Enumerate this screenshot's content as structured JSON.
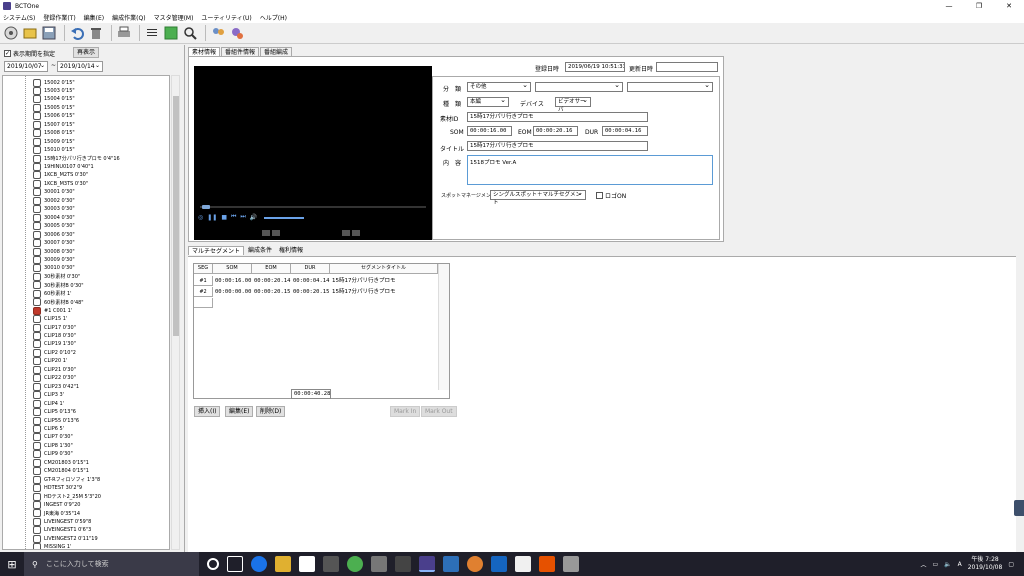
{
  "window": {
    "title": "BCTOne",
    "controls": [
      "—",
      "❐",
      "✕"
    ]
  },
  "menu": [
    "システム(S)",
    "登録作業(T)",
    "編集(E)",
    "編成作業(Q)",
    "マスタ管理(M)",
    "ユーティリティ(U)",
    "ヘルプ(H)"
  ],
  "left": {
    "show_period_label": "表示期間を指定",
    "show_period_checked": true,
    "redisplay_button": "再表示",
    "date_from": "2019/10/07",
    "date_to": "2019/10/14",
    "date_sep": "~",
    "tree_items": [
      "15002 0'15\"",
      "15003 0'15\"",
      "15004 0'15\"",
      "15005 0'15\"",
      "15006 0'15\"",
      "15007 0'15\"",
      "15008 0'15\"",
      "15009 0'15\"",
      "15010 0'15\"",
      "15時17分パリ行きプロモ 0'4\"16",
      "19HINU0107 0'40\"1",
      "1KCB_M2TS 0'30\"",
      "1KCB_M3TS 0'30\"",
      "30001 0'30\"",
      "30002 0'30\"",
      "30003 0'30\"",
      "30004 0'30\"",
      "30005 0'30\"",
      "30006 0'30\"",
      "30007 0'30\"",
      "30008 0'30\"",
      "30009 0'30\"",
      "30010 0'30\"",
      "30秒素材 0'30\"",
      "30秒素材B 0'30\"",
      "60秒素材 1'",
      "60秒素材B 0'48\"",
      "#1 C001 1'",
      "CLIP15 1'",
      "CLIP17 0'30\"",
      "CLIP18 0'30\"",
      "CLIP19 1'30\"",
      "CLIP2 0'10\"2",
      "CLIP20 1'",
      "CLIP21 0'30\"",
      "CLIP22 0'30\"",
      "CLIP23 0'42\"1",
      "CLIP3 3'",
      "CLIP4 1'",
      "CLIP5 0'13\"6",
      "CLIP55 0'13\"6",
      "CLIP6 5'",
      "CLIP7 0'30\"",
      "CLIP8 1'30\"",
      "CLIP9 0'30\"",
      "CM201803 0'15\"1",
      "CM201804 0'15\"1",
      "GT-Rフィロソフィ 1'3\"8",
      "HDTEST 30'2\"9",
      "HDテスト2_25M 5'3\"20",
      "INGEST 0'9\"20",
      "JR東海 0'35\"14",
      "LIVEINGEST 0'59\"8",
      "LIVEINGEST1 0'6\"3",
      "LIVEINGEST2 0'11\"19",
      "MISSING 1'"
    ]
  },
  "tabs": [
    "素材情報",
    "番組件情報",
    "番組編成"
  ],
  "form": {
    "reg_date_label": "登録日時",
    "reg_date": "2019/06/19 10:51:33",
    "upd_date_label": "更新日時",
    "upd_date": "",
    "category_label": "分　類",
    "category_value": "その他",
    "kind_label": "種　類",
    "kind_value": "本編",
    "device_label": "デバイス",
    "device_value": "ビデオサーバ",
    "material_id_label": "素材ID",
    "material_id": "15時17分パリ行きプロモ",
    "som_label": "SOM",
    "som": "00:00:16.00",
    "eom_label": "EOM",
    "eom": "00:00:20.16",
    "dur_label": "DUR",
    "dur": "00:00:04.16",
    "title_label": "タイトル",
    "title": "15時17分パリ行きプロモ",
    "content_label": "内　容",
    "content": "1518プロモ Ver.A",
    "spot_label": "スポットマネージメント",
    "spot_value": "シングルスポット＋マルチセグメント",
    "logo_label": "ロゴON",
    "logo_checked": false
  },
  "lower_tabs": [
    "マルチセグメント",
    "編成条件",
    "権利情報"
  ],
  "grid": {
    "headers": [
      "SEG",
      "SOM",
      "EOM",
      "DUR",
      "セグメントタイトル"
    ],
    "rows": [
      {
        "seg": "#1",
        "som": "00:00:16.00",
        "eom": "00:00:20.14",
        "dur": "00:00:04.14",
        "title": "15時17分パリ行きプロモ"
      },
      {
        "seg": "#2",
        "som": "00:00:00.00",
        "eom": "00:00:20.15",
        "dur": "00:00:20.15",
        "title": "15時17分パリ行きプロモ"
      }
    ],
    "total": "00:00:40.28"
  },
  "buttons": {
    "insert": "挿入(I)",
    "edit": "編集(E)",
    "delete": "削除(D)",
    "mark_in": "Mark In",
    "mark_out": "Mark Out"
  },
  "taskbar": {
    "search_placeholder": "ここに入力して検索",
    "time": "午後 7:28",
    "date": "2019/10/08"
  }
}
